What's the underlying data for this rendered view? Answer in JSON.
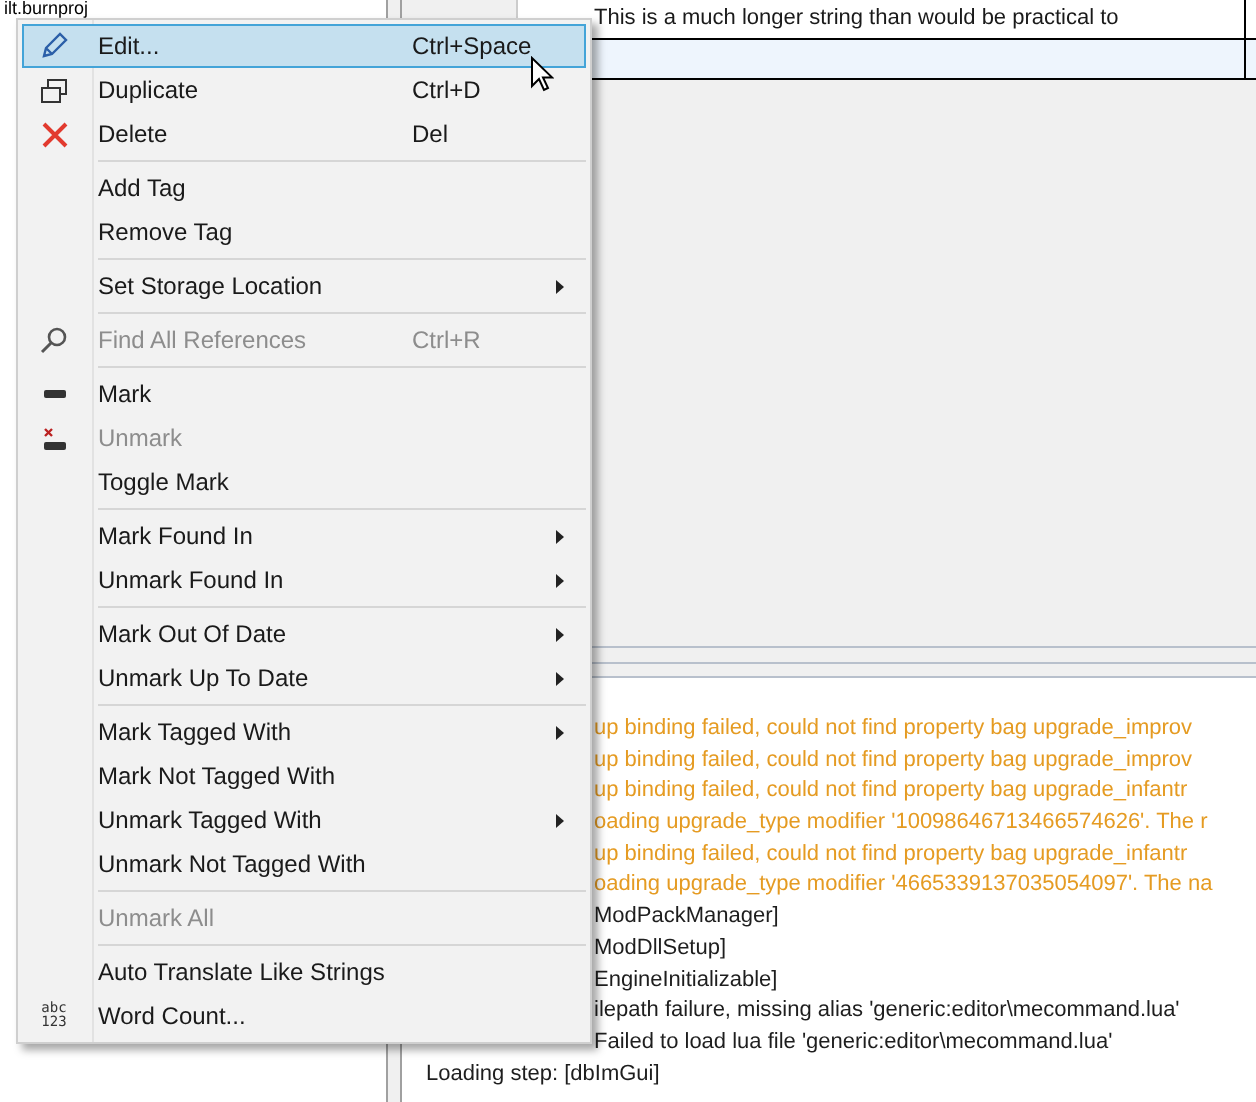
{
  "project_pane": {
    "path": "ilt.burnproj"
  },
  "grid": {
    "rows": [
      {
        "text": "This is a much longer string than would be practical to",
        "selected": false
      },
      {
        "text": "",
        "selected": true
      }
    ]
  },
  "log": {
    "lines": [
      {
        "kind": "warning",
        "text": "up binding failed, could not find property bag upgrade_improv"
      },
      {
        "kind": "warning",
        "text": "up binding failed, could not find property bag upgrade_improv"
      },
      {
        "kind": "warning",
        "text": "up binding failed, could not find property bag upgrade_infantr"
      },
      {
        "kind": "warning",
        "text": "oading upgrade_type modifier '10098646713466574626'. The r"
      },
      {
        "kind": "warning",
        "text": "up binding failed, could not find property bag upgrade_infantr"
      },
      {
        "kind": "warning",
        "text": "oading upgrade_type modifier '4665339137035054097'. The na"
      },
      {
        "kind": "info",
        "text": "ModPackManager]"
      },
      {
        "kind": "info",
        "text": "ModDllSetup]"
      },
      {
        "kind": "info",
        "text": "EngineInitializable]"
      },
      {
        "kind": "info",
        "text": "ilepath failure, missing alias 'generic:editor\\mecommand.lua'"
      },
      {
        "kind": "info",
        "text": "Failed to load lua file 'generic:editor\\mecommand.lua'"
      },
      {
        "kind": "info",
        "text": "Loading step: [dbImGui]"
      }
    ]
  },
  "context_menu": {
    "items": [
      {
        "kind": "item",
        "label": "Edit...",
        "shortcut": "Ctrl+Space",
        "selected": true,
        "disabled": false
      },
      {
        "kind": "item",
        "label": "Duplicate",
        "shortcut": "Ctrl+D",
        "selected": false,
        "disabled": false
      },
      {
        "kind": "item",
        "label": "Delete",
        "shortcut": "Del",
        "selected": false,
        "disabled": false
      },
      {
        "kind": "separator"
      },
      {
        "kind": "item",
        "label": "Add Tag",
        "selected": false,
        "disabled": false
      },
      {
        "kind": "item",
        "label": "Remove Tag",
        "selected": false,
        "disabled": false
      },
      {
        "kind": "separator"
      },
      {
        "kind": "submenu",
        "label": "Set Storage Location",
        "selected": false,
        "disabled": false
      },
      {
        "kind": "separator"
      },
      {
        "kind": "item",
        "label": "Find All References",
        "shortcut": "Ctrl+R",
        "selected": false,
        "disabled": true
      },
      {
        "kind": "separator"
      },
      {
        "kind": "item",
        "label": "Mark",
        "selected": false,
        "disabled": false
      },
      {
        "kind": "item",
        "label": "Unmark",
        "selected": false,
        "disabled": true
      },
      {
        "kind": "item",
        "label": "Toggle Mark",
        "selected": false,
        "disabled": false
      },
      {
        "kind": "separator"
      },
      {
        "kind": "submenu",
        "label": "Mark Found In",
        "selected": false,
        "disabled": false
      },
      {
        "kind": "submenu",
        "label": "Unmark Found In",
        "selected": false,
        "disabled": false
      },
      {
        "kind": "separator"
      },
      {
        "kind": "submenu",
        "label": "Mark Out Of Date",
        "selected": false,
        "disabled": false
      },
      {
        "kind": "submenu",
        "label": "Unmark Up To Date",
        "selected": false,
        "disabled": false
      },
      {
        "kind": "separator"
      },
      {
        "kind": "submenu",
        "label": "Mark Tagged With",
        "selected": false,
        "disabled": false
      },
      {
        "kind": "item",
        "label": "Mark Not Tagged With",
        "selected": false,
        "disabled": false
      },
      {
        "kind": "submenu",
        "label": "Unmark Tagged With",
        "selected": false,
        "disabled": false
      },
      {
        "kind": "item",
        "label": "Unmark Not Tagged With",
        "selected": false,
        "disabled": false
      },
      {
        "kind": "separator"
      },
      {
        "kind": "item",
        "label": "Unmark All",
        "selected": false,
        "disabled": true
      },
      {
        "kind": "separator"
      },
      {
        "kind": "item",
        "label": "Auto Translate Like Strings",
        "selected": false,
        "disabled": false
      },
      {
        "kind": "item",
        "label": "Word Count...",
        "icon_text": [
          "abc",
          "123"
        ],
        "selected": false,
        "disabled": false
      }
    ]
  }
}
